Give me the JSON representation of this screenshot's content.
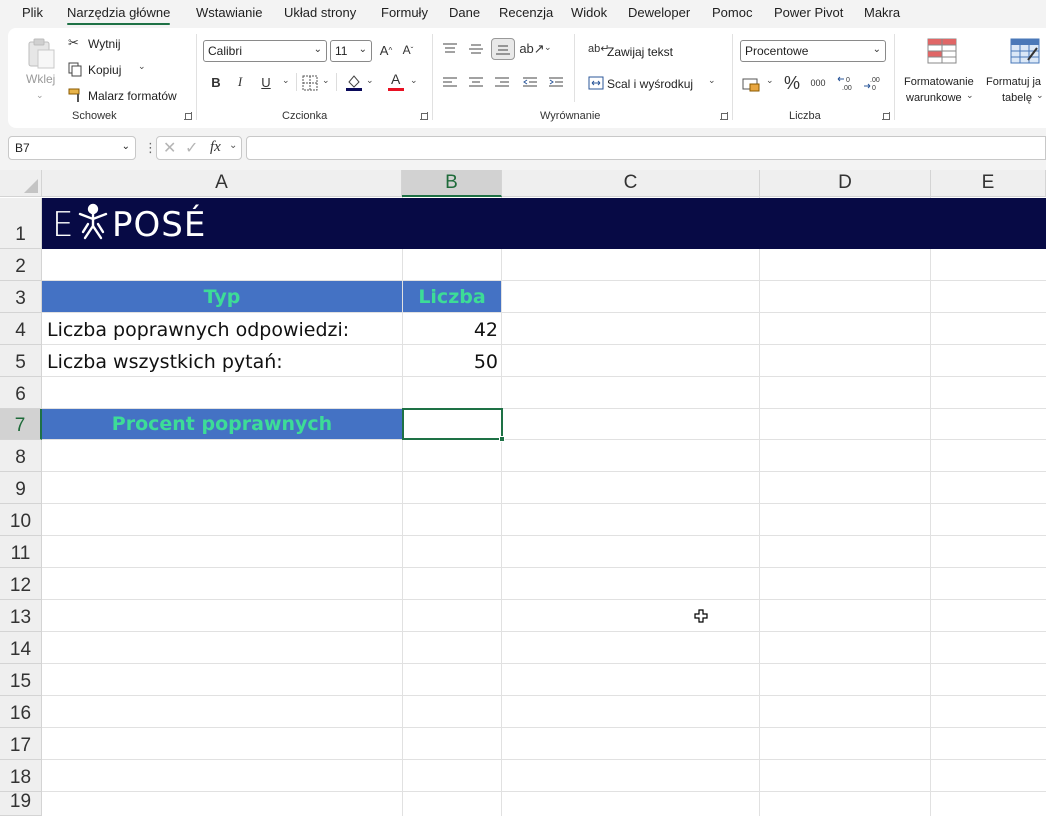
{
  "menu": {
    "tabs": [
      "Plik",
      "Narzędzia główne",
      "Wstawianie",
      "Układ strony",
      "Formuły",
      "Dane",
      "Recenzja",
      "Widok",
      "Deweloper",
      "Pomoc",
      "Power Pivot",
      "Makra"
    ],
    "active": "Narzędzia główne"
  },
  "ribbon": {
    "clipboard": {
      "paste_label": "Wklej",
      "cut_label": "Wytnij",
      "copy_label": "Kopiuj",
      "format_painter_label": "Malarz formatów",
      "group_label": "Schowek"
    },
    "font": {
      "font_name": "Calibri",
      "font_size": "11",
      "bold": "B",
      "italic": "I",
      "underline": "U",
      "group_label": "Czcionka",
      "fill_color": "#0a0a5a",
      "font_color": "#e81123"
    },
    "alignment": {
      "wrap_text_label": "Zawijaj tekst",
      "merge_label": "Scal i wyśrodkuj",
      "group_label": "Wyrównanie"
    },
    "number": {
      "format_value": "Procentowe",
      "percent_symbol": "%",
      "thousands": "000",
      "group_label": "Liczba"
    },
    "styles": {
      "conditional_line1": "Formatowanie",
      "conditional_line2": "warunkowe",
      "format_table_line1": "Formatuj ja",
      "format_table_line2": "tabelę"
    }
  },
  "formula_bar": {
    "name_box": "B7",
    "fx": "fx",
    "formula": ""
  },
  "sheet": {
    "columns": [
      "A",
      "B",
      "C",
      "D",
      "E"
    ],
    "selected_column": "B",
    "rows": [
      "1",
      "2",
      "3",
      "4",
      "5",
      "6",
      "7",
      "8",
      "9",
      "10",
      "11",
      "12",
      "13",
      "14",
      "15",
      "16",
      "17",
      "18",
      "19"
    ],
    "selected_row": "7",
    "logo_text": "EXPOSÉ",
    "header_typ": "Typ",
    "header_liczba": "Liczba",
    "row4_label": "Liczba poprawnych odpowiedzi:",
    "row4_value": "42",
    "row5_label": "Liczba wszystkich pytań:",
    "row5_value": "50",
    "row7_label": "Procent poprawnych",
    "banner_color": "#070a45",
    "header_fill": "#4472c4",
    "header_text_color": "#3ddc97",
    "selection_color": "#1e7145"
  }
}
